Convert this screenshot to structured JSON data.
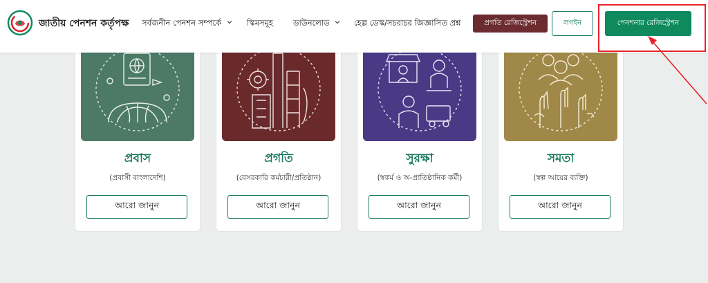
{
  "header": {
    "brand": "জাতীয় পেনশন কর্তৃপক্ষ",
    "nav": [
      {
        "label": "সর্বজনীন পেনশন সম্পর্কে",
        "dropdown": true
      },
      {
        "label": "স্কিমসমূহ",
        "dropdown": false
      },
      {
        "label": "ডাউনলোড",
        "dropdown": true
      },
      {
        "label": "হেল্প ডেস্ক/সচরাচর জিজ্ঞাসিত প্রশ্ন",
        "dropdown": false
      }
    ],
    "pragati_button": "প্রগতি রেজিস্ট্রেশন",
    "login_button": "লগইন",
    "register_button": "পেনশনার রেজিস্ট্রেশন"
  },
  "cards": [
    {
      "title": "প্রবাস",
      "subtitle": "(প্রবাসী বাংলাদেশি)",
      "button": "আরো জানুন",
      "bg": "#4d7a67",
      "title_color": "#1a7a5e",
      "icon": "globe-passport-icon"
    },
    {
      "title": "প্রগতি",
      "subtitle": "(বেসরকারি কর্মচারী/প্রতিষ্ঠান)",
      "button": "আরো জানুন",
      "bg": "#6a2a2c",
      "title_color": "#1a7a5e",
      "icon": "factory-icon"
    },
    {
      "title": "সুরক্ষা",
      "subtitle": "(স্বকর্ম ও অ-প্রাতিষ্ঠানিক কর্মী)",
      "button": "আরো জানুন",
      "bg": "#4a3a86",
      "title_color": "#1a7a5e",
      "icon": "shop-worker-icon"
    },
    {
      "title": "সমতা",
      "subtitle": "(স্বল্প আয়ের ব্যক্তি)",
      "button": "আরো জানুন",
      "bg": "#a08848",
      "title_color": "#1a7a5e",
      "icon": "people-hands-icon"
    }
  ],
  "colors": {
    "accent": "#0f8a5f",
    "highlight": "#e8232a",
    "pragati": "#6b2b2f"
  }
}
